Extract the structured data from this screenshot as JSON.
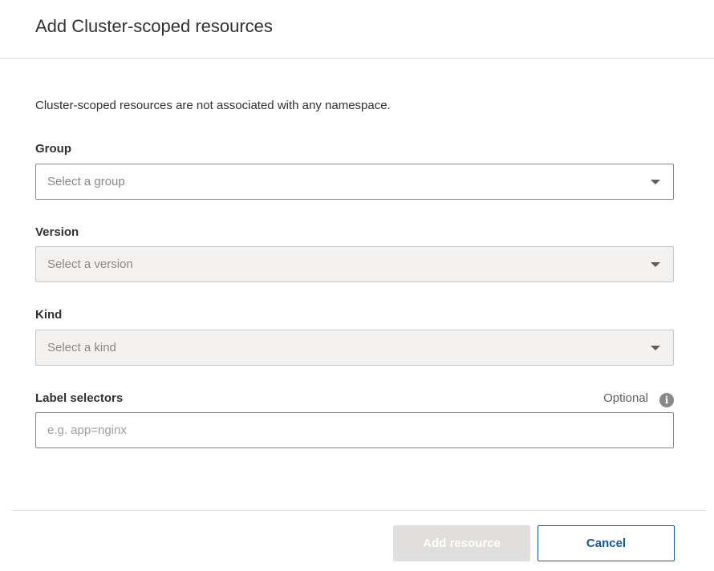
{
  "dialog": {
    "title": "Add Cluster-scoped resources",
    "description": "Cluster-scoped resources are not associated with any namespace."
  },
  "fields": {
    "group": {
      "label": "Group",
      "placeholder": "Select a group",
      "disabled": false
    },
    "version": {
      "label": "Version",
      "placeholder": "Select a version",
      "disabled": true
    },
    "kind": {
      "label": "Kind",
      "placeholder": "Select a kind",
      "disabled": true
    },
    "label_selectors": {
      "label": "Label selectors",
      "optional_text": "Optional",
      "placeholder": "e.g. app=nginx",
      "value": ""
    }
  },
  "icons": {
    "info": "info-icon",
    "chevron": "chevron-down-icon"
  },
  "footer": {
    "primary_label": "Add resource",
    "secondary_label": "Cancel"
  },
  "colors": {
    "accent": "#0f5aa5",
    "disabled_button": "#e1dfdd"
  }
}
